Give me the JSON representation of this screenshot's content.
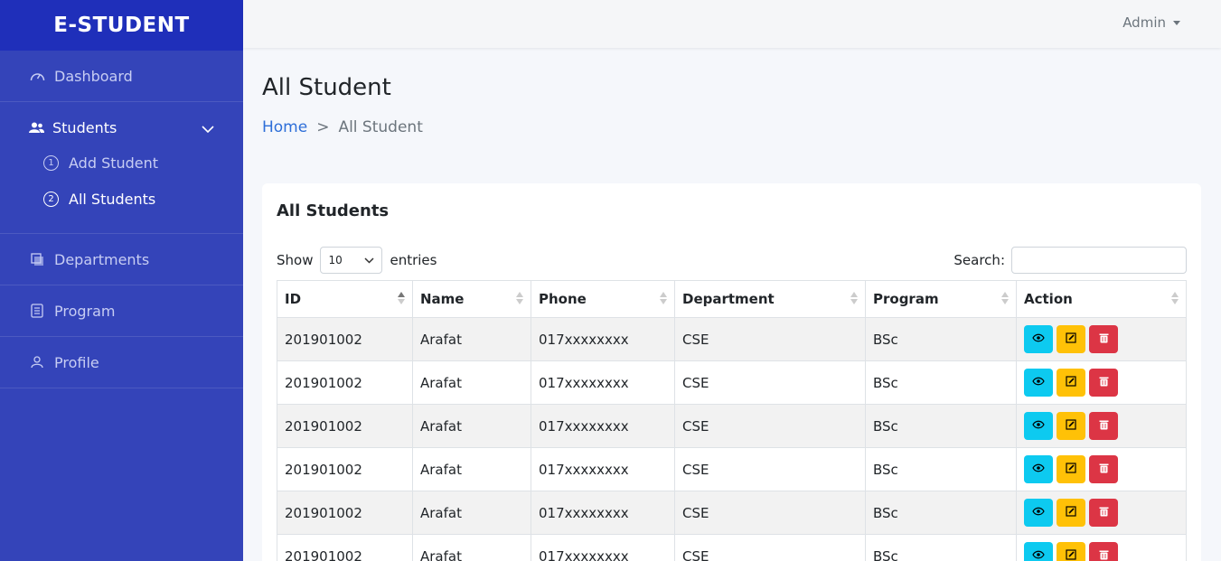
{
  "brand": "E-STUDENT",
  "admin_label": "Admin",
  "nav": {
    "dashboard": "Dashboard",
    "students": "Students",
    "add_student": "Add Student",
    "add_num": "1",
    "all_students": "All Students",
    "all_num": "2",
    "departments": "Departments",
    "program": "Program",
    "profile": "Profile"
  },
  "page": {
    "title": "All Student",
    "breadcrumb_home": "Home",
    "breadcrumb_sep": ">",
    "breadcrumb_current": "All Student"
  },
  "card": {
    "title": "All Students",
    "show": "Show",
    "entries_value": "10",
    "entries": "entries",
    "search_label": "Search:"
  },
  "table": {
    "columns": [
      "ID",
      "Name",
      "Phone",
      "Department",
      "Program",
      "Action"
    ],
    "rows": [
      [
        "201901002",
        "Arafat",
        "017xxxxxxxx",
        "CSE",
        "BSc"
      ],
      [
        "201901002",
        "Arafat",
        "017xxxxxxxx",
        "CSE",
        "BSc"
      ],
      [
        "201901002",
        "Arafat",
        "017xxxxxxxx",
        "CSE",
        "BSc"
      ],
      [
        "201901002",
        "Arafat",
        "017xxxxxxxx",
        "CSE",
        "BSc"
      ],
      [
        "201901002",
        "Arafat",
        "017xxxxxxxx",
        "CSE",
        "BSc"
      ],
      [
        "201901002",
        "Arafat",
        "017xxxxxxxx",
        "CSE",
        "BSc"
      ]
    ]
  },
  "icons": {
    "view": "eye-icon",
    "edit": "edit-icon",
    "delete": "trash-icon"
  },
  "colors": {
    "sidebar": "#3444b9",
    "brand_bg": "#1f2fba",
    "view": "#0dcaf0",
    "edit": "#ffc107",
    "delete": "#dc3545",
    "link": "#2d6ed8"
  }
}
